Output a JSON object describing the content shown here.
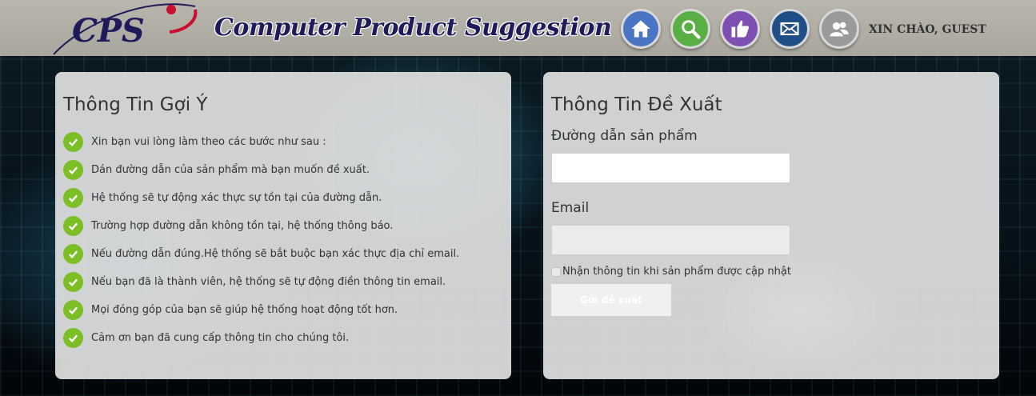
{
  "header": {
    "logo_text": "CPS",
    "site_title": "Computer Product Suggestion",
    "greeting": "XIN CHÀO, GUEST",
    "nav": [
      {
        "name": "home",
        "icon": "home-icon",
        "color": "#4a74c4"
      },
      {
        "name": "search",
        "icon": "search-icon",
        "color": "#58b045"
      },
      {
        "name": "suggest",
        "icon": "thumbs-up-icon",
        "color": "#7d4fb2"
      },
      {
        "name": "contact",
        "icon": "mail-icon",
        "color": "#1f4f86"
      },
      {
        "name": "user",
        "icon": "user-icon",
        "color": "#9a9a9a"
      }
    ]
  },
  "info_panel": {
    "title": "Thông Tin Gợi Ý",
    "steps": [
      "Xin bạn vui lòng làm theo các bước như sau :",
      "Dán đường dẫn của sản phẩm mà bạn muốn đề xuất.",
      "Hệ thống sẽ tự động xác thực sự tồn tại của đường dẫn.",
      "Trường hợp đường dẫn không tồn tại, hệ thống thông báo.",
      "Nếu đường dẫn đúng.Hệ thống sẽ bắt buộc bạn xác thực địa chỉ email.",
      "Nếu bạn đã là thành viên, hệ thống sẽ tự động điền thông tin email.",
      "Mọi đóng góp của bạn sẽ giúp hệ thống hoạt động tốt hơn.",
      "Cảm ơn bạn đã cung cấp thông tin cho chúng tôi."
    ]
  },
  "form_panel": {
    "title": "Thông Tin Đề Xuất",
    "url_label": "Đường dẫn sản phẩm",
    "url_value": "",
    "email_label": "Email",
    "email_value": "",
    "subscribe_label": "Nhận thông tin khi sản phẩm được cập nhật",
    "submit_label": "Gửi đề xuất"
  },
  "colors": {
    "check": "#7cbe25",
    "panel": "#e0e0e0"
  }
}
